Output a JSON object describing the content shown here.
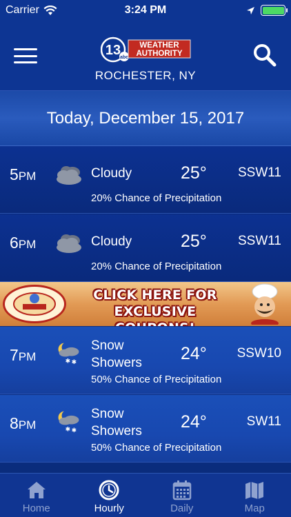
{
  "status_bar": {
    "carrier": "Carrier",
    "time": "3:24 PM"
  },
  "header": {
    "logo_channel": "13",
    "logo_network": "abc",
    "logo_line1": "WEATHER",
    "logo_line2": "AUTHORITY",
    "location": "ROCHESTER, NY"
  },
  "date_label": "Today, December 15, 2017",
  "hours": [
    {
      "hour": "5",
      "ampm": "PM",
      "icon": "cloudy-icon",
      "condition": "Cloudy",
      "temp": "25°",
      "wind": "SSW11",
      "precip": "20% Chance of Precipitation"
    },
    {
      "hour": "6",
      "ampm": "PM",
      "icon": "cloudy-icon",
      "condition": "Cloudy",
      "temp": "25°",
      "wind": "SSW11",
      "precip": "20% Chance of Precipitation"
    },
    {
      "hour": "7",
      "ampm": "PM",
      "icon": "snow-showers-night-icon",
      "condition_line1": "Snow",
      "condition_line2": "Showers",
      "temp": "24°",
      "wind": "SSW10",
      "precip": "50% Chance of Precipitation"
    },
    {
      "hour": "8",
      "ampm": "PM",
      "icon": "snow-showers-night-icon",
      "condition_line1": "Snow",
      "condition_line2": "Showers",
      "temp": "24°",
      "wind": "SW11",
      "precip": "50% Chance of Precipitation"
    }
  ],
  "ad": {
    "line1": "CLICK HERE FOR",
    "line2": "EXCLUSIVE COUPONS!"
  },
  "tabs": [
    {
      "label": "Home",
      "icon": "home-icon",
      "active": false
    },
    {
      "label": "Hourly",
      "icon": "clock-icon",
      "active": true
    },
    {
      "label": "Daily",
      "icon": "calendar-icon",
      "active": false
    },
    {
      "label": "Map",
      "icon": "map-icon",
      "active": false
    }
  ],
  "colors": {
    "background": "#0a2a78",
    "header": "#0d3593",
    "accent_red": "#b8261d",
    "tab_inactive": "#8fa2cf",
    "battery_green": "#4cd964"
  }
}
